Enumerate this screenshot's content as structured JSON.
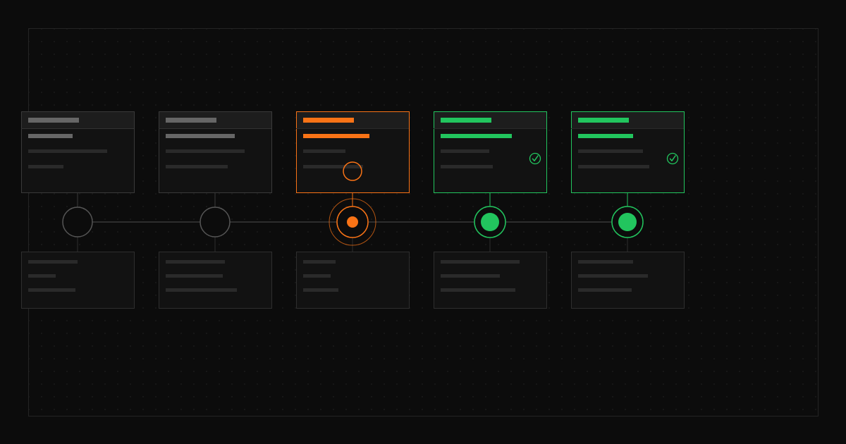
{
  "colors": {
    "background": "#0c0c0c",
    "frame_border": "#242424",
    "pending": "#555555",
    "pending_bar": "#666666",
    "active": "#f97316",
    "complete": "#22c55e",
    "muted_bar": "#2a2a2a",
    "panel_fill": "#121212",
    "header_fill": "#1d1d1d"
  },
  "steps": [
    {
      "state": "pending",
      "top_card": {
        "header_fill": 0.45,
        "lines": [
          0.45,
          0.8,
          0.36
        ]
      },
      "bottom_card": {
        "lines": [
          0.5,
          0.28,
          0.48
        ]
      },
      "checked": false
    },
    {
      "state": "pending",
      "top_card": {
        "header_fill": 0.45,
        "lines": [
          0.7,
          0.8,
          0.63
        ]
      },
      "bottom_card": {
        "lines": [
          0.6,
          0.58,
          0.72
        ]
      },
      "checked": false
    },
    {
      "state": "active",
      "top_card": {
        "header_fill": 0.45,
        "lines": [
          0.67,
          0.43,
          0.61
        ]
      },
      "bottom_card": {
        "lines": [
          0.33,
          0.28,
          0.36
        ]
      },
      "checked": false,
      "cursor_icon": "ring-cursor-icon"
    },
    {
      "state": "complete",
      "top_card": {
        "header_fill": 0.45,
        "lines": [
          0.72,
          0.49,
          0.53
        ]
      },
      "bottom_card": {
        "lines": [
          0.8,
          0.6,
          0.76
        ]
      },
      "checked": true,
      "check_icon": "check-circle-icon"
    },
    {
      "state": "complete",
      "top_card": {
        "header_fill": 0.45,
        "lines": [
          0.56,
          0.66,
          0.72
        ]
      },
      "bottom_card": {
        "lines": [
          0.56,
          0.71,
          0.54
        ]
      },
      "checked": true,
      "check_icon": "check-circle-icon"
    }
  ]
}
